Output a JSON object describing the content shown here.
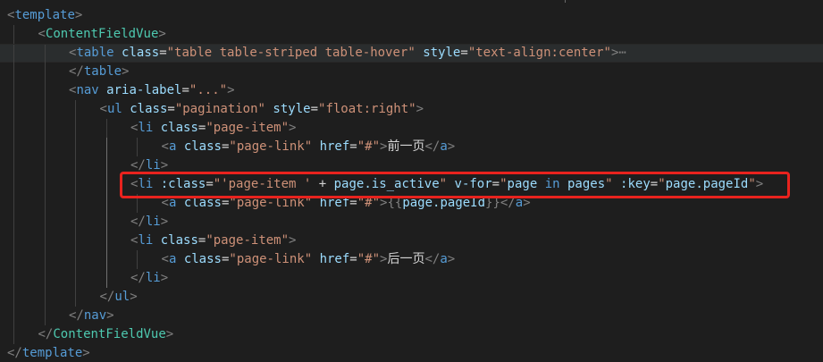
{
  "editor": {
    "lines": [
      {
        "indent": 0,
        "tokens": [
          [
            "bracket",
            "<"
          ],
          [
            "tag",
            "template"
          ],
          [
            "bracket",
            ">"
          ]
        ]
      },
      {
        "indent": 1,
        "tokens": [
          [
            "bracket",
            "<"
          ],
          [
            "comp",
            "ContentFieldVue"
          ],
          [
            "bracket",
            ">"
          ]
        ]
      },
      {
        "indent": 2,
        "current": true,
        "tokens": [
          [
            "bracket",
            "<"
          ],
          [
            "tag",
            "table"
          ],
          [
            "text",
            " "
          ],
          [
            "attr",
            "class"
          ],
          [
            "eq",
            "="
          ],
          [
            "str",
            "\"table table-striped table-hover\""
          ],
          [
            "text",
            " "
          ],
          [
            "attr",
            "style"
          ],
          [
            "eq",
            "="
          ],
          [
            "str",
            "\"text-align:center\""
          ],
          [
            "bracket",
            ">"
          ],
          [
            "fold",
            "⋯"
          ]
        ]
      },
      {
        "indent": 2,
        "tokens": [
          [
            "bracket",
            "</"
          ],
          [
            "tag",
            "table"
          ],
          [
            "bracket",
            ">"
          ]
        ]
      },
      {
        "indent": 2,
        "tokens": [
          [
            "bracket",
            "<"
          ],
          [
            "tag",
            "nav"
          ],
          [
            "text",
            " "
          ],
          [
            "attr",
            "aria-label"
          ],
          [
            "eq",
            "="
          ],
          [
            "str",
            "\"...\""
          ],
          [
            "bracket",
            ">"
          ]
        ]
      },
      {
        "indent": 3,
        "tokens": [
          [
            "bracket",
            "<"
          ],
          [
            "tag",
            "ul"
          ],
          [
            "text",
            " "
          ],
          [
            "attr",
            "class"
          ],
          [
            "eq",
            "="
          ],
          [
            "str",
            "\"pagination\""
          ],
          [
            "text",
            " "
          ],
          [
            "attr",
            "style"
          ],
          [
            "eq",
            "="
          ],
          [
            "str",
            "\"float:right\""
          ],
          [
            "bracket",
            ">"
          ]
        ]
      },
      {
        "indent": 4,
        "tokens": [
          [
            "bracket",
            "<"
          ],
          [
            "tag",
            "li"
          ],
          [
            "text",
            " "
          ],
          [
            "attr",
            "class"
          ],
          [
            "eq",
            "="
          ],
          [
            "str",
            "\"page-item\""
          ],
          [
            "bracket",
            ">"
          ]
        ]
      },
      {
        "indent": 5,
        "tokens": [
          [
            "bracket",
            "<"
          ],
          [
            "tag",
            "a"
          ],
          [
            "text",
            " "
          ],
          [
            "attr",
            "class"
          ],
          [
            "eq",
            "="
          ],
          [
            "str",
            "\"page-link\""
          ],
          [
            "text",
            " "
          ],
          [
            "attr",
            "href"
          ],
          [
            "eq",
            "="
          ],
          [
            "str",
            "\"#\""
          ],
          [
            "bracket",
            ">"
          ],
          [
            "text",
            "前一页"
          ],
          [
            "bracket",
            "</"
          ],
          [
            "tag",
            "a"
          ],
          [
            "bracket",
            ">"
          ]
        ]
      },
      {
        "indent": 4,
        "tokens": [
          [
            "bracket",
            "</"
          ],
          [
            "tag",
            "li"
          ],
          [
            "bracket",
            ">"
          ]
        ]
      },
      {
        "indent": 4,
        "tokens": [
          [
            "bracket",
            "<"
          ],
          [
            "tag",
            "li"
          ],
          [
            "text",
            " "
          ],
          [
            "attr",
            ":class"
          ],
          [
            "eq",
            "="
          ],
          [
            "str",
            "\"'page-item ' "
          ],
          [
            "text",
            "+ "
          ],
          [
            "expr",
            "page.is_active"
          ],
          [
            "str",
            "\""
          ],
          [
            "text",
            " "
          ],
          [
            "attr",
            "v-for"
          ],
          [
            "eq",
            "="
          ],
          [
            "str",
            "\""
          ],
          [
            "expr",
            "page"
          ],
          [
            "text",
            " "
          ],
          [
            "tag",
            "in"
          ],
          [
            "text",
            " "
          ],
          [
            "expr",
            "pages"
          ],
          [
            "str",
            "\""
          ],
          [
            "text",
            " "
          ],
          [
            "attr",
            ":key"
          ],
          [
            "eq",
            "="
          ],
          [
            "str",
            "\""
          ],
          [
            "expr",
            "page.pageId"
          ],
          [
            "str",
            "\""
          ],
          [
            "bracket",
            ">"
          ]
        ]
      },
      {
        "indent": 5,
        "tokens": [
          [
            "bracket",
            "<"
          ],
          [
            "tag",
            "a"
          ],
          [
            "text",
            " "
          ],
          [
            "attr",
            "class"
          ],
          [
            "eq",
            "="
          ],
          [
            "str",
            "\"page-link\""
          ],
          [
            "text",
            " "
          ],
          [
            "attr",
            "href"
          ],
          [
            "eq",
            "="
          ],
          [
            "str",
            "\"#\""
          ],
          [
            "bracket",
            ">"
          ],
          [
            "bracket",
            "{{"
          ],
          [
            "expr",
            "page.pageId"
          ],
          [
            "bracket",
            "}}"
          ],
          [
            "bracket",
            "</"
          ],
          [
            "tag",
            "a"
          ],
          [
            "bracket",
            ">"
          ]
        ]
      },
      {
        "indent": 4,
        "tokens": [
          [
            "bracket",
            "</"
          ],
          [
            "tag",
            "li"
          ],
          [
            "bracket",
            ">"
          ]
        ]
      },
      {
        "indent": 4,
        "tokens": [
          [
            "bracket",
            "<"
          ],
          [
            "tag",
            "li"
          ],
          [
            "text",
            " "
          ],
          [
            "attr",
            "class"
          ],
          [
            "eq",
            "="
          ],
          [
            "str",
            "\"page-item\""
          ],
          [
            "bracket",
            ">"
          ]
        ]
      },
      {
        "indent": 5,
        "tokens": [
          [
            "bracket",
            "<"
          ],
          [
            "tag",
            "a"
          ],
          [
            "text",
            " "
          ],
          [
            "attr",
            "class"
          ],
          [
            "eq",
            "="
          ],
          [
            "str",
            "\"page-link\""
          ],
          [
            "text",
            " "
          ],
          [
            "attr",
            "href"
          ],
          [
            "eq",
            "="
          ],
          [
            "str",
            "\"#\""
          ],
          [
            "bracket",
            ">"
          ],
          [
            "text",
            "后一页"
          ],
          [
            "bracket",
            "</"
          ],
          [
            "tag",
            "a"
          ],
          [
            "bracket",
            ">"
          ]
        ]
      },
      {
        "indent": 4,
        "tokens": [
          [
            "bracket",
            "</"
          ],
          [
            "tag",
            "li"
          ],
          [
            "bracket",
            ">"
          ]
        ]
      },
      {
        "indent": 3,
        "tokens": [
          [
            "bracket",
            "</"
          ],
          [
            "tag",
            "ul"
          ],
          [
            "bracket",
            ">"
          ]
        ]
      },
      {
        "indent": 2,
        "tokens": [
          [
            "bracket",
            "</"
          ],
          [
            "tag",
            "nav"
          ],
          [
            "bracket",
            ">"
          ]
        ]
      },
      {
        "indent": 1,
        "tokens": [
          [
            "bracket",
            "</"
          ],
          [
            "comp",
            "ContentFieldVue"
          ],
          [
            "bracket",
            ">"
          ]
        ]
      },
      {
        "indent": 0,
        "tokens": [
          [
            "bracket",
            "</"
          ],
          [
            "tag",
            "template"
          ],
          [
            "bracket",
            ">"
          ]
        ]
      }
    ],
    "highlighted_line": 9
  },
  "colors": {
    "background": "#1e1e1e",
    "tag": "#569cd6",
    "component": "#4ec9b0",
    "attribute": "#9cdcfe",
    "string": "#ce9178",
    "bracket": "#808080",
    "highlight_box": "#e8231e"
  }
}
